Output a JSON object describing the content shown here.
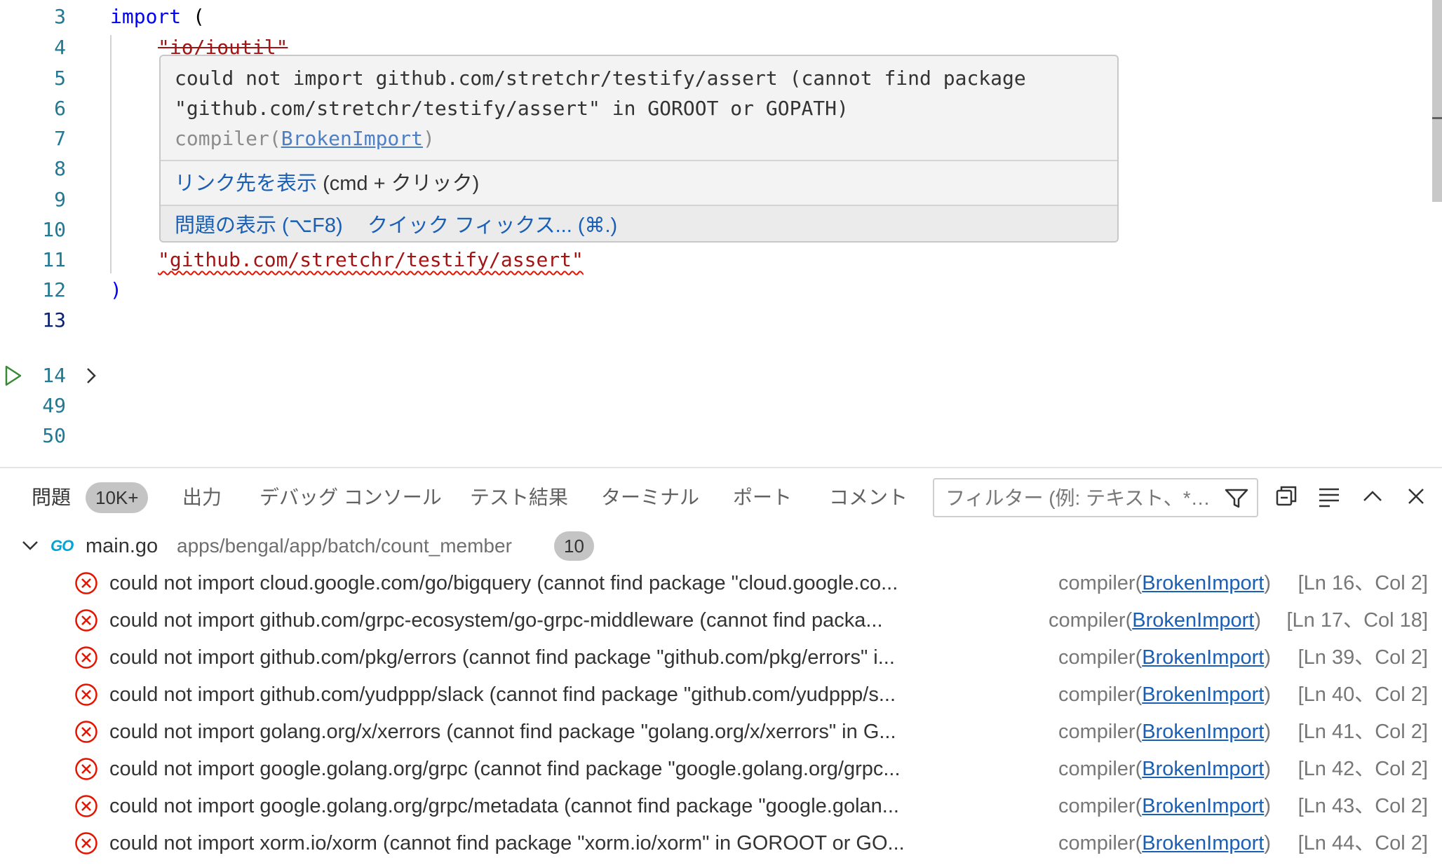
{
  "editor": {
    "lines": [
      {
        "num": "3",
        "kw": "import",
        "rest": " ("
      },
      {
        "num": "4",
        "str": "\"io/ioutil\""
      },
      {
        "num": "5"
      },
      {
        "num": "6"
      },
      {
        "num": "7"
      },
      {
        "num": "8"
      },
      {
        "num": "9"
      },
      {
        "num": "10"
      },
      {
        "num": "11",
        "str": "\"github.com/stretchr/testify/assert\""
      },
      {
        "num": "12",
        "text": ")"
      },
      {
        "num": "13"
      },
      {
        "num": "14"
      },
      {
        "num": "49"
      },
      {
        "num": "50"
      }
    ]
  },
  "hover": {
    "message": "could not import github.com/stretchr/testify/assert (cannot find package \"github.com/stretchr/testify/assert\" in GOROOT or GOPATH)",
    "source": "compiler(",
    "code": "BrokenImport",
    "source_end": ")",
    "follow_link": "リンク先を表示",
    "follow_hint": " (cmd + クリック)",
    "view_problem": "問題の表示 (⌥F8)",
    "quick_fix": "クイック フィックス... (⌘.)"
  },
  "panel": {
    "tabs": {
      "problems": "問題",
      "problems_count": "10K+",
      "output": "出力",
      "debug_console": "デバッグ コンソール",
      "test_results": "テスト結果",
      "terminal": "ターミナル",
      "ports": "ポート",
      "comments": "コメント"
    },
    "filter_placeholder": "フィルター (例: テキスト、*…",
    "file": {
      "name": "main.go",
      "path": "apps/bengal/app/batch/count_member",
      "count": "10",
      "logo": "GO"
    },
    "problems": [
      {
        "msg": "could not import cloud.google.com/go/bigquery (cannot find package \"cloud.google.co...",
        "source": "compiler(",
        "code": "BrokenImport",
        "source_end": ")",
        "loc": "[Ln 16、Col 2]"
      },
      {
        "msg": "could not import github.com/grpc-ecosystem/go-grpc-middleware (cannot find packa...",
        "source": "compiler(",
        "code": "BrokenImport",
        "source_end": ")",
        "loc": "[Ln 17、Col 18]"
      },
      {
        "msg": "could not import github.com/pkg/errors (cannot find package \"github.com/pkg/errors\" i...",
        "source": "compiler(",
        "code": "BrokenImport",
        "source_end": ")",
        "loc": "[Ln 39、Col 2]"
      },
      {
        "msg": "could not import github.com/yudppp/slack (cannot find package \"github.com/yudppp/s...",
        "source": "compiler(",
        "code": "BrokenImport",
        "source_end": ")",
        "loc": "[Ln 40、Col 2]"
      },
      {
        "msg": "could not import golang.org/x/xerrors (cannot find package \"golang.org/x/xerrors\" in G...",
        "source": "compiler(",
        "code": "BrokenImport",
        "source_end": ")",
        "loc": "[Ln 41、Col 2]"
      },
      {
        "msg": "could not import google.golang.org/grpc (cannot find package \"google.golang.org/grpc...",
        "source": "compiler(",
        "code": "BrokenImport",
        "source_end": ")",
        "loc": "[Ln 42、Col 2]"
      },
      {
        "msg": "could not import google.golang.org/grpc/metadata (cannot find package \"google.golan...",
        "source": "compiler(",
        "code": "BrokenImport",
        "source_end": ")",
        "loc": "[Ln 43、Col 2]"
      },
      {
        "msg": "could not import xorm.io/xorm (cannot find package \"xorm.io/xorm\" in GOROOT or GO...",
        "source": "compiler(",
        "code": "BrokenImport",
        "source_end": ")",
        "loc": "[Ln 44、Col 2]"
      }
    ]
  },
  "colors": {
    "error": "#e51400",
    "link": "#1a5fb4",
    "line_number": "#237893",
    "keyword": "#0000ff",
    "string": "#a31515"
  },
  "icons": [
    "run-icon",
    "fold-chevron-icon",
    "filter-icon",
    "collapse-all-icon",
    "word-wrap-icon",
    "maximize-panel-icon",
    "close-panel-icon",
    "chevron-down-icon",
    "go-file-icon",
    "error-icon"
  ]
}
